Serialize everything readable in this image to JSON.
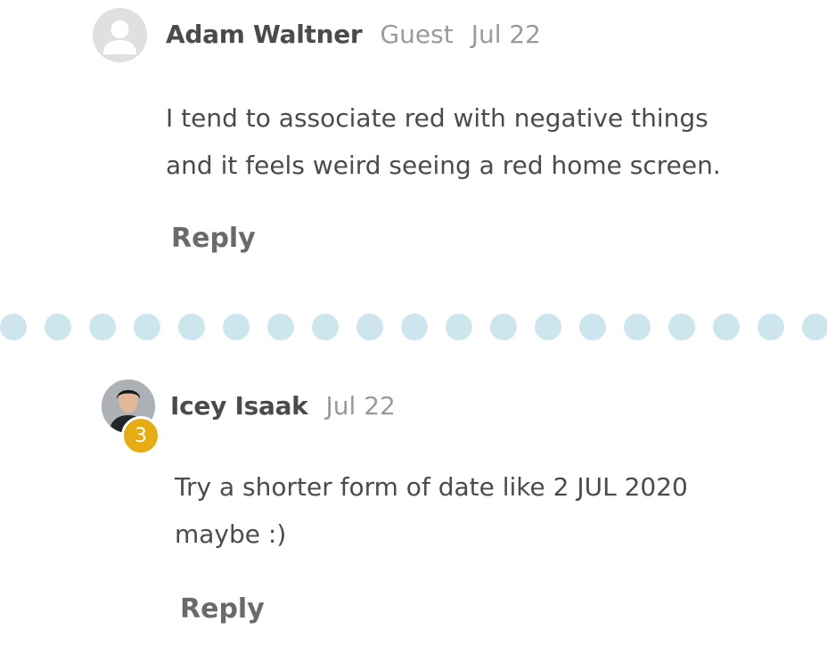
{
  "comments": [
    {
      "author": "Adam Waltner",
      "role": "Guest",
      "date": "Jul 22",
      "avatar_icon": "user-placeholder-icon",
      "body_lines": [
        "I tend to associate red with negative things",
        "and it feels weird seeing a red home screen."
      ],
      "reply_label": "Reply"
    },
    {
      "author": "Icey Isaak",
      "date": "Jul 22",
      "avatar_icon": "user-photo-avatar",
      "badge": "3",
      "body_lines": [
        "Try a shorter form of date like 2 JUL 2020",
        "maybe :)"
      ],
      "reply_label": "Reply"
    }
  ],
  "colors": {
    "divider_dot": "#cde6ee",
    "badge": "#e6ad12",
    "text": "#4b4b4b",
    "muted": "#9a9a9a"
  }
}
